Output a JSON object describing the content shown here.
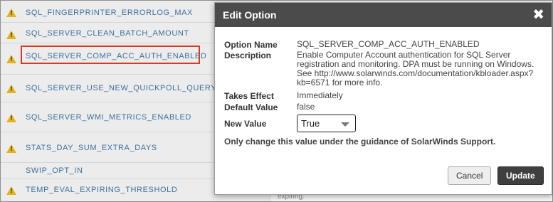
{
  "list": {
    "items": [
      {
        "name": "SQL_FINGERPRINTER_ERRORLOG_MAX",
        "warning": true
      },
      {
        "name": "SQL_SERVER_CLEAN_BATCH_AMOUNT",
        "warning": true
      },
      {
        "name": "SQL_SERVER_COMP_ACC_AUTH_ENABLED",
        "warning": true,
        "highlighted": true
      },
      {
        "name": "SQL_SERVER_USE_NEW_QUICKPOLL_QUERY",
        "warning": true
      },
      {
        "name": "SQL_SERVER_WMI_METRICS_ENABLED",
        "warning": true
      },
      {
        "name": "STATS_DAY_SUM_EXTRA_DAYS",
        "warning": true
      },
      {
        "name": "SWIP_OPT_IN",
        "warning": false
      },
      {
        "name": "TEMP_EVAL_EXPIRING_THRESHOLD",
        "warning": true
      }
    ],
    "bottom_fragment": "expiring."
  },
  "modal": {
    "title": "Edit Option",
    "close_glyph": "✖",
    "option_name_label": "Option Name",
    "option_name_value": "SQL_SERVER_COMP_ACC_AUTH_ENABLED",
    "description_label": "Description",
    "description_lines": [
      "Enable Computer Account authentication for SQL Server",
      "registration and monitoring. DPA must be running on Windows.",
      "See http://www.solarwinds.com/documentation/kbloader.aspx?",
      "kb=6571 for more info."
    ],
    "takes_effect_label": "Takes Effect",
    "takes_effect_value": "Immediately",
    "default_value_label": "Default Value",
    "default_value_value": "false",
    "new_value_label": "New Value",
    "new_value_selected": "True",
    "guidance": "Only change this value under the guidance of SolarWinds Support.",
    "cancel_label": "Cancel",
    "update_label": "Update"
  },
  "colors": {
    "warning": "#e2b41c",
    "highlight_border": "#d63a2a",
    "link_text": "#3d6f9e",
    "modal_header": "#4b4b4b",
    "update_button": "#3f3f3f"
  }
}
